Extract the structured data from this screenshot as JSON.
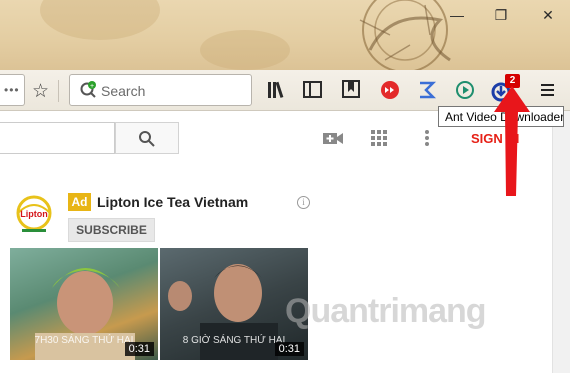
{
  "browser": {
    "window_controls": {
      "minimize": "—",
      "restore": "❐",
      "close": "✕"
    },
    "search_placeholder": "Search",
    "url_dots": "•••",
    "addon_badge_count": "2",
    "tooltip": "Ant Video Downloader",
    "toolbar_icons": [
      "library-icon",
      "reader-view-icon",
      "bookmark-panel-icon",
      "youtube-addon-icon",
      "sigma-addon-icon",
      "play-addon-icon",
      "ant-downloader-icon",
      "hamburger-menu-icon"
    ]
  },
  "youtube": {
    "sign_in": "SIGN IN",
    "ad": {
      "badge": "Ad",
      "title": "Lipton Ice Tea Vietnam",
      "subscribe": "SUBSCRIBE",
      "logo_text": "Lipton"
    },
    "videos": [
      {
        "caption": "7H30 SÁNG THỨ HAI",
        "duration": "0:31"
      },
      {
        "caption": "8 GIỜ SÁNG THỨ HAI",
        "duration": "0:31"
      }
    ]
  },
  "watermark": "Quantrimang",
  "colors": {
    "signin": "#e62117",
    "ad_badge": "#e8b515",
    "arrow": "#e8161b",
    "badge": "#d50000"
  }
}
